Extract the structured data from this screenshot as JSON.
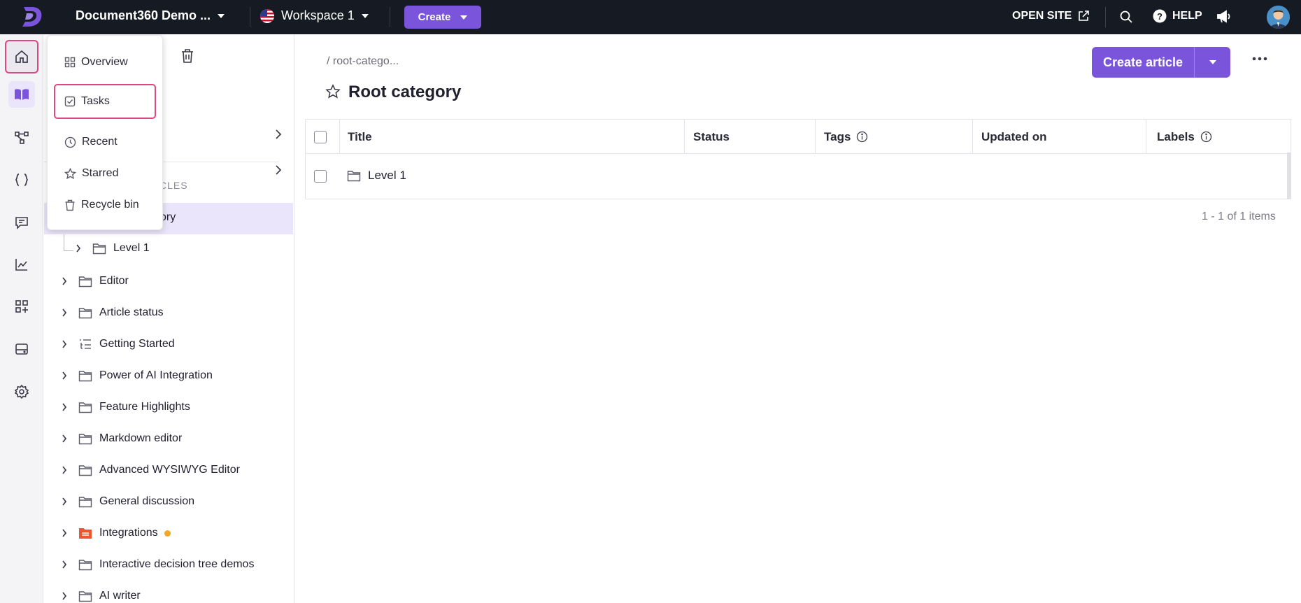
{
  "topbar": {
    "project_name": "Document360 Demo ...",
    "workspace": "Workspace 1",
    "create_label": "Create",
    "open_site_label": "OPEN SITE",
    "help_label": "HELP"
  },
  "rail": {
    "items": [
      "home-icon",
      "documentation-icon",
      "api-docs-icon",
      "api-reference-icon",
      "feedback-icon",
      "analytics-icon",
      "integrations-icon",
      "widgets-icon",
      "settings-icon"
    ],
    "active": "documentation-icon",
    "highlighted": "home-icon"
  },
  "menu": {
    "items": [
      "Overview",
      "Tasks",
      "Recent",
      "Starred",
      "Recycle bin"
    ],
    "highlighted": "Tasks"
  },
  "sidebar": {
    "section_label_partial": "CLES",
    "selected_partial": "ory",
    "child": "Level 1",
    "categories": [
      {
        "label": "Editor",
        "icon": "folder-icon"
      },
      {
        "label": "Article status",
        "icon": "folder-icon"
      },
      {
        "label": "Getting Started",
        "icon": "list-icon"
      },
      {
        "label": "Power of AI Integration",
        "icon": "folder-icon"
      },
      {
        "label": "Feature Highlights",
        "icon": "folder-icon"
      },
      {
        "label": "Markdown editor",
        "icon": "folder-icon"
      },
      {
        "label": "Advanced WYSIWYG Editor",
        "icon": "folder-icon"
      },
      {
        "label": "General discussion",
        "icon": "folder-icon"
      },
      {
        "label": "Integrations",
        "icon": "orange-folder-icon",
        "status_dot": "#f5a623"
      },
      {
        "label": "Interactive decision tree demos",
        "icon": "folder-icon"
      },
      {
        "label": "AI writer",
        "icon": "folder-icon"
      }
    ]
  },
  "main": {
    "breadcrumb": "/ root-catego...",
    "title": "Root category",
    "create_article_label": "Create article",
    "table": {
      "columns": [
        "Title",
        "Status",
        "Tags",
        "Updated on",
        "Labels"
      ],
      "rows": [
        {
          "title": "Level 1",
          "status": "",
          "tags": "",
          "updated_on": "",
          "labels": ""
        }
      ]
    },
    "pagination": "1 - 1 of 1 items"
  },
  "colors": {
    "accent": "#7a55dc",
    "highlight": "#e0467f",
    "topbar": "#161a22"
  }
}
